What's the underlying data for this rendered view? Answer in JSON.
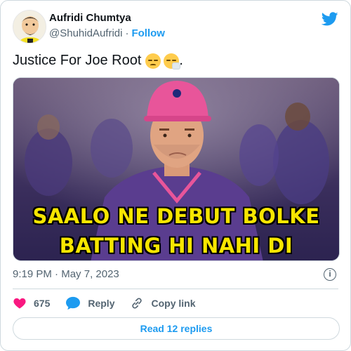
{
  "author": {
    "display_name": "Aufridi Chumtya",
    "handle": "@ShuhidAufridi",
    "separator": "·",
    "follow_label": "Follow"
  },
  "tweet": {
    "text": "Justice For Joe Root",
    "trailing": ".",
    "emojis": [
      "disappointed-face",
      "sneezing-face"
    ]
  },
  "media": {
    "caption_line1": "SAALO NE DEBUT BOLKE",
    "caption_line2": "BATTING HI NAHI DI"
  },
  "meta": {
    "time": "9:19 PM",
    "separator": "·",
    "date": "May 7, 2023",
    "info_glyph": "i"
  },
  "actions": {
    "likes": "675",
    "reply_label": "Reply",
    "copy_link_label": "Copy link"
  },
  "replies_button": "Read 12 replies",
  "colors": {
    "brand_blue": "#1d9bf0",
    "like_red": "#f91880",
    "caption_yellow": "#f7e600",
    "jersey_purple": "#5a3d8f",
    "cap_pink": "#e8559a"
  }
}
